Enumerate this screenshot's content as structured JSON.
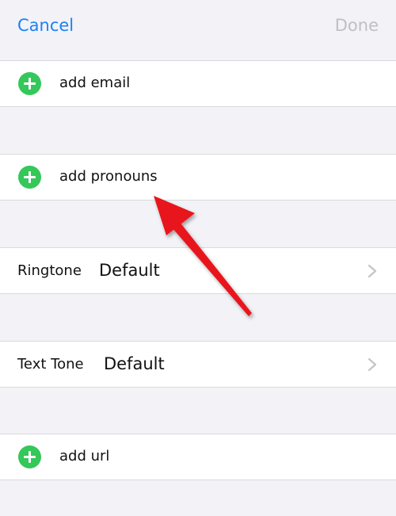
{
  "navbar": {
    "cancel_label": "Cancel",
    "done_label": "Done"
  },
  "fields": {
    "email": {
      "label": "add email",
      "icon": "add-circle-icon"
    },
    "pronouns": {
      "label": "add pronouns",
      "icon": "add-circle-icon"
    },
    "ringtone": {
      "label": "Ringtone",
      "value": "Default",
      "icon": "chevron-right-icon"
    },
    "text_tone": {
      "label": "Text Tone",
      "value": "Default",
      "icon": "chevron-right-icon"
    },
    "url": {
      "label": "add url",
      "icon": "add-circle-icon"
    }
  },
  "colors": {
    "accent_blue": "#1a82f6",
    "disabled_gray": "#bfbfc4",
    "add_green": "#34c759",
    "arrow_red": "#e8141b",
    "background": "#f2f2f7"
  }
}
